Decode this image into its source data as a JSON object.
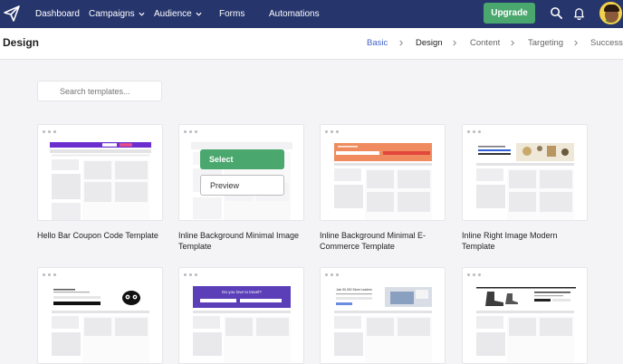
{
  "nav": {
    "items": [
      {
        "label": "Dashboard",
        "has_dropdown": false
      },
      {
        "label": "Campaigns",
        "has_dropdown": true
      },
      {
        "label": "Audience",
        "has_dropdown": true
      },
      {
        "label": "Forms",
        "has_dropdown": false
      },
      {
        "label": "Automations",
        "has_dropdown": false
      }
    ],
    "upgrade_label": "Upgrade",
    "colors": {
      "nav_bg": "#26356c",
      "upgrade_bg": "#4aa76d"
    }
  },
  "header": {
    "title": "Design",
    "steps": [
      "Basic",
      "Design",
      "Content",
      "Targeting",
      "Success"
    ],
    "active_step": "Design"
  },
  "search": {
    "placeholder": "Search templates..."
  },
  "templates": [
    {
      "name": "Hello Bar Coupon Code Template"
    },
    {
      "name": "Inline Background Minimal Image Template",
      "hovered": true
    },
    {
      "name": "Inline Background Minimal E-Commerce Template"
    },
    {
      "name": "Inline Right Image Modern Template"
    },
    {
      "name": ""
    },
    {
      "name": ""
    },
    {
      "name": ""
    },
    {
      "name": ""
    }
  ],
  "hover_actions": {
    "select_label": "Select",
    "preview_label": "Preview"
  },
  "thumb_text": {
    "travel_banner": "Do you love to travel?",
    "seo_headline": "Join 50,000 Store Leaders"
  }
}
